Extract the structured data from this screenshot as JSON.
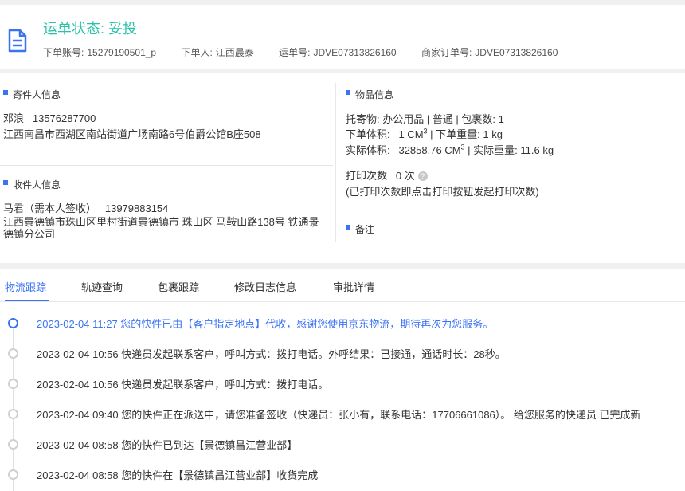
{
  "header": {
    "status_label": "运单状态:",
    "status_value": "妥投",
    "meta": [
      {
        "label": "下单账号:",
        "value": "15279190501_p"
      },
      {
        "label": "下单人:",
        "value": "江西晨泰"
      },
      {
        "label": "运单号:",
        "value": "JDVE07313826160"
      },
      {
        "label": "商家订单号:",
        "value": "JDVE07313826160"
      }
    ]
  },
  "sender": {
    "title": "寄件人信息",
    "name": "邓浪",
    "phone": "13576287700",
    "address": "江西南昌市西湖区南站街道广场南路6号伯爵公馆B座508"
  },
  "receiver": {
    "title": "收件人信息",
    "name": "马君（需本人签收）",
    "phone": "13979883154",
    "address": "江西景德镇市珠山区里村街道景德镇市 珠山区 马鞍山路138号 铁通景德镇分公司"
  },
  "goods": {
    "title": "物品信息",
    "line1": "托寄物:  办公用品 | 普通  |  包裹数:  1",
    "order_volume_label": "下单体积:",
    "order_volume": "1 CM",
    "order_weight": "|  下单重量:   1 kg",
    "actual_volume_label": "实际体积:",
    "actual_volume": "32858.76 CM",
    "actual_weight": "|  实际重量:   11.6 kg",
    "cube_sup": "3",
    "print_label": "打印次数",
    "print_count": "0 次",
    "print_hint": "(已打印次数即点击打印按钮发起打印次数)",
    "help_glyph": "?"
  },
  "remarks": {
    "title": "备注"
  },
  "tabs": [
    {
      "label": "物流跟踪",
      "active": true
    },
    {
      "label": "轨迹查询"
    },
    {
      "label": "包裹跟踪"
    },
    {
      "label": "修改日志信息"
    },
    {
      "label": "审批详情"
    }
  ],
  "timeline": [
    {
      "text": "2023-02-04 11:27 您的快件已由【客户指定地点】代收，感谢您使用京东物流，期待再次为您服务。",
      "active": true
    },
    {
      "text": "2023-02-04 10:56 快递员发起联系客户，呼叫方式：拨打电话。外呼结果：已接通，通话时长：28秒。"
    },
    {
      "text": "2023-02-04 10:56 快递员发起联系客户，呼叫方式：拨打电话。"
    },
    {
      "text": "2023-02-04 09:40 您的快件正在派送中，请您准备签收（快递员：张小有，联系电话：17706661086）。 给您服务的快递员 已完成新"
    },
    {
      "text": "2023-02-04 08:58 您的快件已到达【景德镇昌江营业部】"
    },
    {
      "text": "2023-02-04 08:58 您的快件在【景德镇昌江营业部】收货完成"
    }
  ],
  "colors": {
    "accent": "#3b73f3",
    "status": "#2bc2a8"
  }
}
